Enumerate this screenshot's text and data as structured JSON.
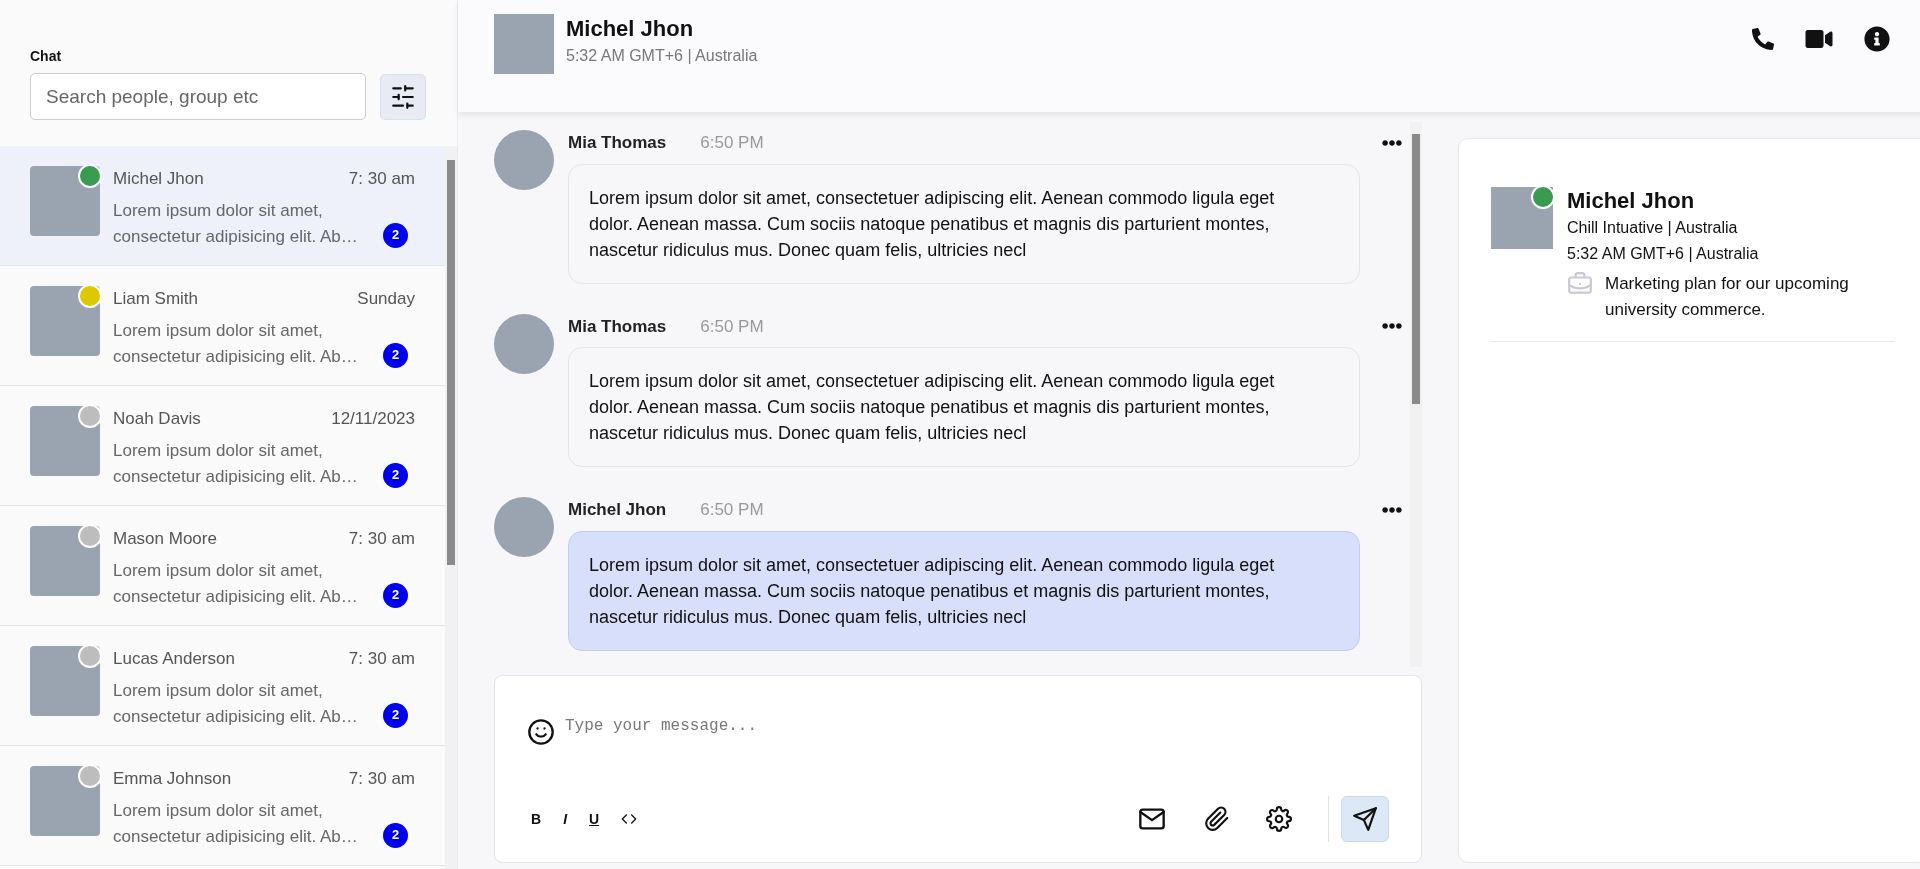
{
  "sidebar": {
    "title": "Chat",
    "search": {
      "placeholder": "Search people, group etc"
    },
    "chats": [
      {
        "name": "Michel Jhon",
        "time": "7: 30 am",
        "preview": "Lorem ipsum dolor sit amet, consectetur adipisicing elit. Ab…",
        "unread": "2",
        "color": "#3a9a4f",
        "selected": true
      },
      {
        "name": "Liam Smith",
        "time": "Sunday",
        "preview": "Lorem ipsum dolor sit amet, consectetur adipisicing elit. Ab…",
        "unread": "2",
        "color": "#e0c800",
        "selected": false
      },
      {
        "name": "Noah Davis",
        "time": "12/11/2023",
        "preview": "Lorem ipsum dolor sit amet, consectetur adipisicing elit. Ab…",
        "unread": "2",
        "color": "#bdbdbd",
        "selected": false
      },
      {
        "name": "Mason Moore",
        "time": "7: 30 am",
        "preview": "Lorem ipsum dolor sit amet, consectetur adipisicing elit. Ab…",
        "unread": "2",
        "color": "#bdbdbd",
        "selected": false
      },
      {
        "name": "Lucas Anderson",
        "time": "7: 30 am",
        "preview": "Lorem ipsum dolor sit amet, consectetur adipisicing elit. Ab…",
        "unread": "2",
        "color": "#bdbdbd",
        "selected": false
      },
      {
        "name": "Emma Johnson",
        "time": "7: 30 am",
        "preview": "Lorem ipsum dolor sit amet, consectetur adipisicing elit. Ab…",
        "unread": "2",
        "color": "#bdbdbd",
        "selected": false
      }
    ]
  },
  "header": {
    "name": "Michel Jhon",
    "subtitle": "5:32 AM GMT+6 | Australia"
  },
  "messages": [
    {
      "sender": "Mia Thomas",
      "time": "6:50 PM",
      "text": "Lorem ipsum dolor sit amet, consectetuer adipiscing elit. Aenean commodo ligula eget dolor. Aenean massa. Cum sociis natoque penatibus et magnis dis parturient montes, nascetur ridiculus mus. Donec quam felis, ultricies necl",
      "highlighted": false
    },
    {
      "sender": "Mia Thomas",
      "time": "6:50 PM",
      "text": "Lorem ipsum dolor sit amet, consectetuer adipiscing elit. Aenean commodo ligula eget dolor. Aenean massa. Cum sociis natoque penatibus et magnis dis parturient montes, nascetur ridiculus mus. Donec quam felis, ultricies necl",
      "highlighted": false
    },
    {
      "sender": "Michel Jhon",
      "time": "6:50 PM",
      "text": "Lorem ipsum dolor sit amet, consectetuer adipiscing elit. Aenean commodo ligula eget dolor. Aenean massa. Cum sociis natoque penatibus et magnis dis parturient montes, nascetur ridiculus mus. Donec quam felis, ultricies necl",
      "highlighted": true
    }
  ],
  "composer": {
    "placeholder": "Type your message...",
    "format_buttons": [
      "B",
      "I",
      "U"
    ]
  },
  "profile": {
    "name": "Michel Jhon",
    "color": "#3a9a4f",
    "company": "Chill Intuative | Australia",
    "time": "5:32 AM GMT+6 | Australia",
    "note": "Marketing plan for our upcoming university commerce."
  }
}
